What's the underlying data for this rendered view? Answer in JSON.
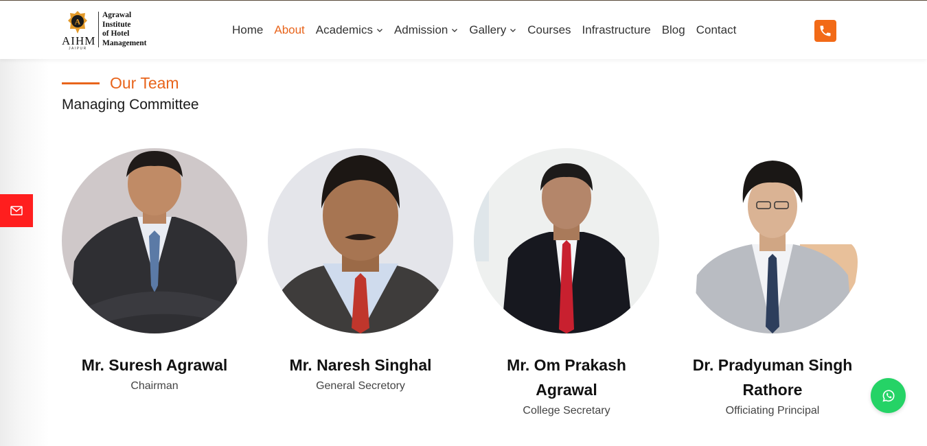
{
  "brand": {
    "emblem_letter": "A",
    "short": "AIHM",
    "city": "JAIPUR",
    "full_name": "Agrawal\nInstitute\nof Hotel\nManagement"
  },
  "nav": {
    "items": [
      {
        "label": "Home",
        "active": false,
        "dropdown": false
      },
      {
        "label": "About",
        "active": true,
        "dropdown": false
      },
      {
        "label": "Academics",
        "active": false,
        "dropdown": true
      },
      {
        "label": "Admission",
        "active": false,
        "dropdown": true
      },
      {
        "label": "Gallery",
        "active": false,
        "dropdown": true
      },
      {
        "label": "Courses",
        "active": false,
        "dropdown": false
      },
      {
        "label": "Infrastructure",
        "active": false,
        "dropdown": false
      },
      {
        "label": "Blog",
        "active": false,
        "dropdown": false
      },
      {
        "label": "Contact",
        "active": false,
        "dropdown": false
      }
    ],
    "phone_icon": "phone-icon"
  },
  "section": {
    "eyebrow": "Our Team",
    "title": "Managing Committee"
  },
  "team": [
    {
      "name": "Mr. Suresh Agrawal",
      "role": "Chairman"
    },
    {
      "name": "Mr. Naresh Singhal",
      "role": "General Secretory"
    },
    {
      "name": "Mr. Om Prakash Agrawal",
      "role": "College Secretary"
    },
    {
      "name": "Dr. Pradyuman Singh Rathore",
      "role": "Officiating Principal"
    }
  ],
  "floating": {
    "mail_icon": "mail-icon",
    "whatsapp_icon": "whatsapp-icon"
  },
  "colors": {
    "accent": "#e8641b",
    "phone_button": "#f26a17",
    "mail_button": "#ff1e1e",
    "whatsapp": "#25d366",
    "text": "#333333"
  }
}
